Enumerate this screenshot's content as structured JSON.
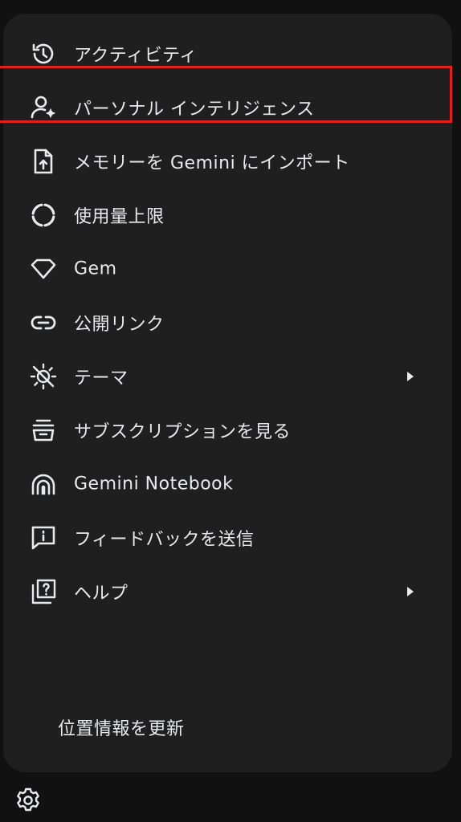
{
  "menu": {
    "items": [
      {
        "label": "アクティビティ",
        "icon": "history-icon"
      },
      {
        "label": "パーソナル インテリジェンス",
        "icon": "person-sparkle-icon"
      },
      {
        "label": "メモリーを Gemini にインポート",
        "icon": "file-upload-icon"
      },
      {
        "label": "使用量上限",
        "icon": "usage-ring-icon"
      },
      {
        "label": "Gem",
        "icon": "gem-icon"
      },
      {
        "label": "公開リンク",
        "icon": "link-icon"
      },
      {
        "label": "テーマ",
        "icon": "theme-icon"
      },
      {
        "label": "サブスクリプションを見る",
        "icon": "subscription-icon"
      },
      {
        "label": "Gemini Notebook",
        "icon": "notebook-icon"
      },
      {
        "label": "フィードバックを送信",
        "icon": "feedback-icon"
      },
      {
        "label": "ヘルプ",
        "icon": "help-icon"
      }
    ],
    "footer_link": "位置情報を更新"
  },
  "colors": {
    "background": "#111111",
    "menu_surface": "#1f1f1f",
    "text": "#e8eaed",
    "highlight_border": "#e0201c"
  },
  "settings_icon": "gear-icon"
}
